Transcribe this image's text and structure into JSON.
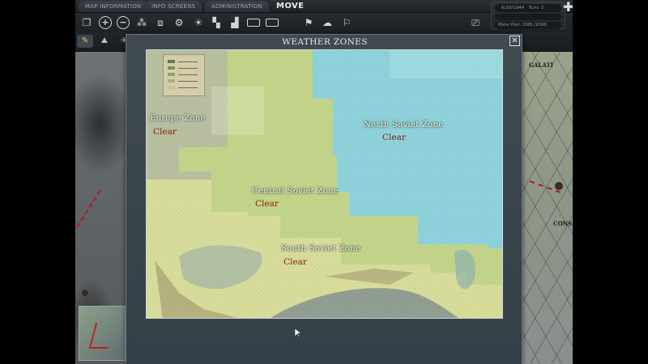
{
  "top_tabs": [
    {
      "label": "MAP INFORMATION"
    },
    {
      "label": "INFO SCREENS"
    },
    {
      "label": "ADMINISTRATION"
    }
  ],
  "phase_label": "MOVE",
  "status": {
    "date": "6/29/1944",
    "turn": "Turn: 2",
    "motor_pool": "Motor Pool: 2086 (1096)"
  },
  "bg_labels": {
    "galati": "GALATI",
    "cons": "CONS"
  },
  "modal": {
    "title": "WEATHER ZONES",
    "close_glyph": "✕"
  },
  "zones": [
    {
      "name": "Europe Zone",
      "condition": "Clear"
    },
    {
      "name": "North Soviet Zone",
      "condition": "Clear"
    },
    {
      "name": "Central Soviet Zone",
      "condition": "Clear"
    },
    {
      "name": "South Soviet Zone",
      "condition": "Clear"
    }
  ],
  "colors": {
    "north_zone": "#8dcfd6",
    "central_zone": "#c3d28a",
    "south_zone": "#d7dc9c",
    "europe_zone": "#b9c1a5",
    "condition_text": "#8a1a12"
  },
  "icons": [
    "window-icon",
    "zoom-in-icon",
    "zoom-out-icon",
    "units-icon",
    "supply-icon",
    "settings-icon",
    "sun-icon",
    "chart-icon",
    "factory-icon",
    "rect-icon",
    "rect-icon",
    "flag-icon",
    "cloud-weather-icon",
    "pennant-icon",
    "screen-icon"
  ]
}
